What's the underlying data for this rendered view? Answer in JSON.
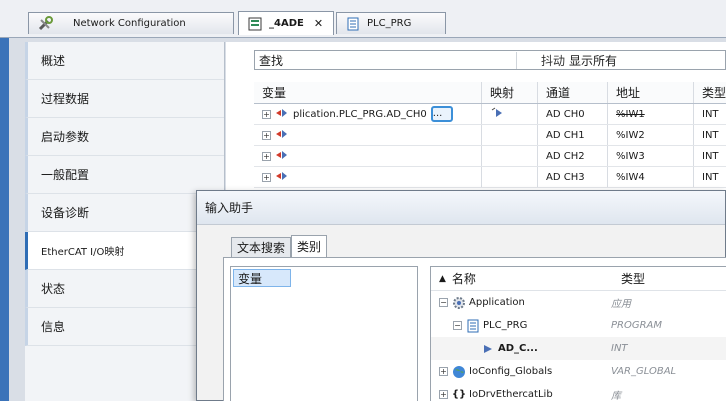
{
  "tabs": [
    {
      "label": "Network Configuration"
    },
    {
      "label": "_4ADE"
    },
    {
      "label": "PLC_PRG"
    }
  ],
  "nav": {
    "items": [
      {
        "label": "概述"
      },
      {
        "label": "过程数据"
      },
      {
        "label": "启动参数"
      },
      {
        "label": "一般配置"
      },
      {
        "label": "设备诊断"
      },
      {
        "label": "EtherCAT I/O映射"
      },
      {
        "label": "状态"
      },
      {
        "label": "信息"
      }
    ],
    "active_index": 5
  },
  "main": {
    "find_label": "查找",
    "filter_label": "抖动",
    "show_all_label": "显示所有",
    "columns": [
      "变量",
      "映射",
      "通道",
      "地址",
      "类型"
    ],
    "rows": [
      {
        "variable": "plication.PLC_PRG.AD_CH0",
        "channel": "AD CH0",
        "address": "%IW1",
        "type": "INT"
      },
      {
        "variable": "",
        "channel": "AD CH1",
        "address": "%IW2",
        "type": "INT"
      },
      {
        "variable": "",
        "channel": "AD CH2",
        "address": "%IW3",
        "type": "INT"
      },
      {
        "variable": "",
        "channel": "AD CH3",
        "address": "%IW4",
        "type": "INT"
      }
    ],
    "dots_button_label": "..."
  },
  "dialog": {
    "title": "输入助手",
    "tabs": [
      {
        "label": "文本搜索"
      },
      {
        "label": "类别"
      }
    ],
    "categories": [
      {
        "label": "变量"
      }
    ],
    "tree_header": {
      "name": "名称",
      "type": "类型"
    },
    "tree_rows": [
      {
        "name": "Application",
        "type": "应用"
      },
      {
        "name": "PLC_PRG",
        "type": "PROGRAM"
      },
      {
        "name": "AD_C...",
        "type": "INT"
      },
      {
        "name": "IoConfig_Globals",
        "type": "VAR_GLOBAL"
      },
      {
        "name": "IoDrvEthercatLib",
        "type": "库"
      }
    ]
  },
  "colors": {
    "accent": "#2f6db5",
    "selection": "#d7e8fb",
    "dots_button_border": "#3c8fd8"
  }
}
